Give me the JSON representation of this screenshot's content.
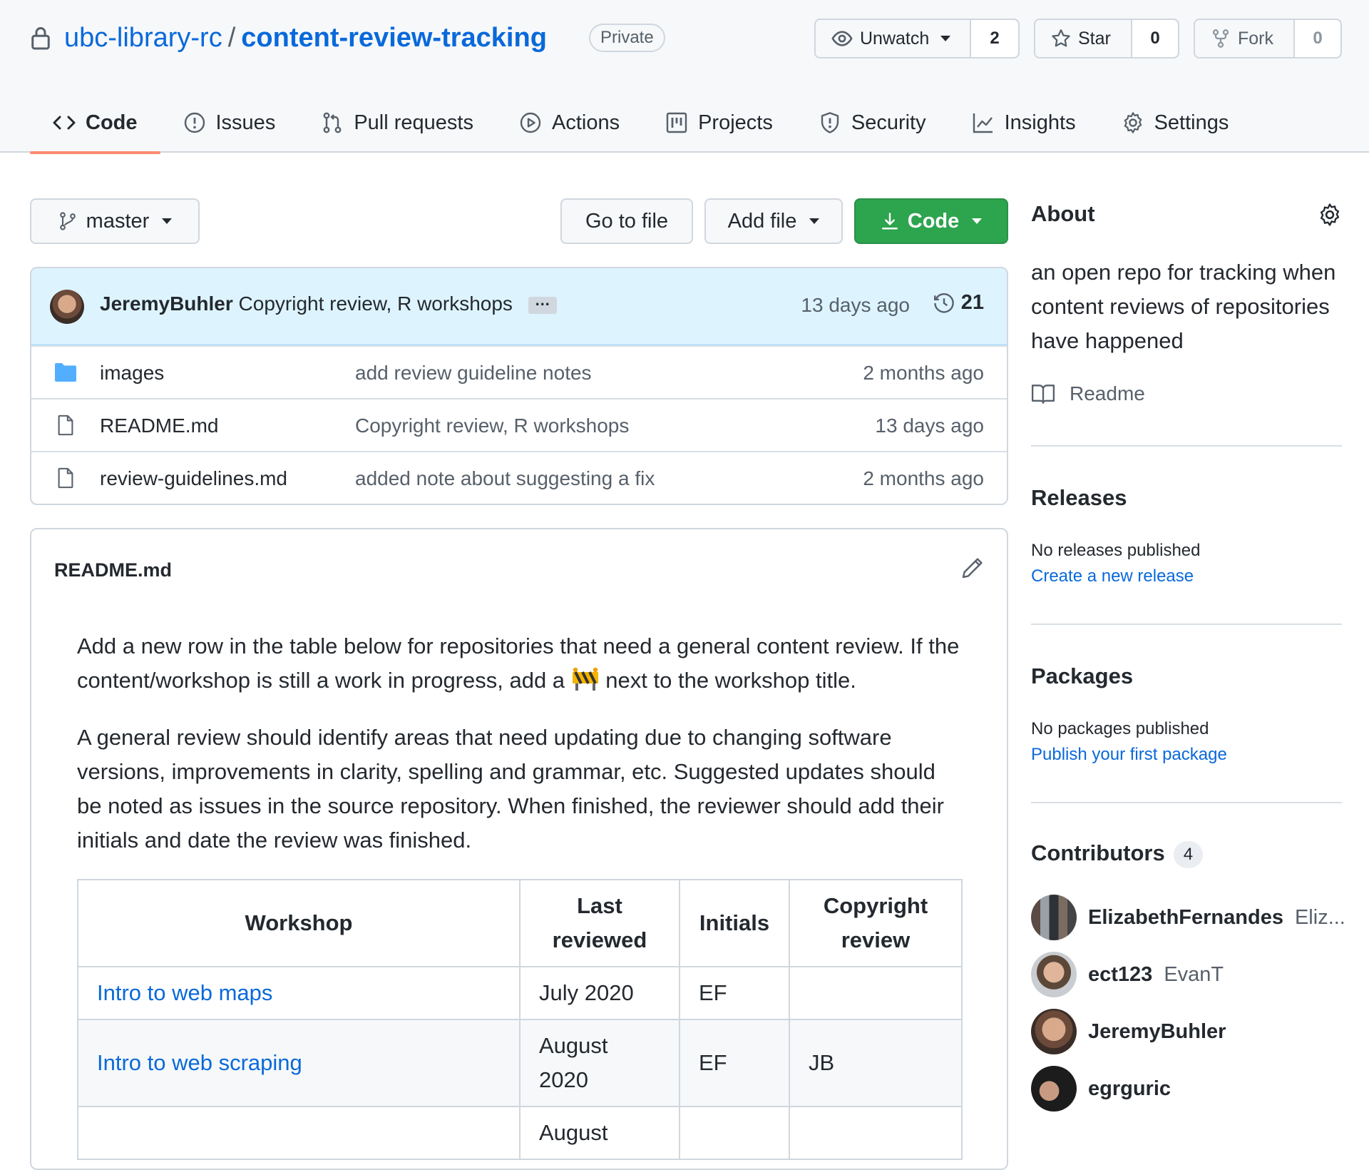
{
  "header": {
    "owner": "ubc-library-rc",
    "separator": "/",
    "repo": "content-review-tracking",
    "visibility": "Private",
    "watch_label": "Unwatch",
    "watch_count": "2",
    "star_label": "Star",
    "star_count": "0",
    "fork_label": "Fork",
    "fork_count": "0"
  },
  "tabs": [
    {
      "label": "Code",
      "icon": "code-icon",
      "active": true
    },
    {
      "label": "Issues",
      "icon": "issue-icon"
    },
    {
      "label": "Pull requests",
      "icon": "pull-request-icon"
    },
    {
      "label": "Actions",
      "icon": "play-icon"
    },
    {
      "label": "Projects",
      "icon": "project-icon"
    },
    {
      "label": "Security",
      "icon": "shield-icon"
    },
    {
      "label": "Insights",
      "icon": "graph-icon"
    },
    {
      "label": "Settings",
      "icon": "gear-icon"
    }
  ],
  "toolbar": {
    "branch": "master",
    "go_to_file": "Go to file",
    "add_file": "Add file",
    "code": "Code"
  },
  "latest_commit": {
    "author": "JeremyBuhler",
    "message": "Copyright review, R workshops",
    "ellipsis": "…",
    "when": "13 days ago",
    "commit_count": "21"
  },
  "files": [
    {
      "name": "images",
      "type": "folder",
      "message": "add review guideline notes",
      "when": "2 months ago"
    },
    {
      "name": "README.md",
      "type": "file",
      "message": "Copyright review, R workshops",
      "when": "13 days ago"
    },
    {
      "name": "review-guidelines.md",
      "type": "file",
      "message": "added note about suggesting a fix",
      "when": "2 months ago"
    }
  ],
  "readme": {
    "title": "README.md",
    "p1_a": "Add a new row in the table below for repositories that need a general content review. If the content/workshop is still a work in progress, add a",
    "p1_b": "next to the workshop title.",
    "p2": "A general review should identify areas that need updating due to changing software versions, improvements in clarity, spelling and grammar, etc. Suggested updates should be noted as issues in the source repository. When finished, the reviewer should add their initials and date the review was finished.",
    "table_headers": [
      "Workshop",
      "Last reviewed",
      "Initials",
      "Copyright review"
    ],
    "rows": [
      {
        "workshop": "Intro to web maps",
        "last_reviewed": "July 2020",
        "initials": "EF",
        "copyright": ""
      },
      {
        "workshop": "Intro to web scraping",
        "last_reviewed": "August 2020",
        "initials": "EF",
        "copyright": "JB"
      },
      {
        "workshop": "",
        "last_reviewed": "August",
        "initials": "",
        "copyright": ""
      }
    ]
  },
  "sidebar": {
    "about_title": "About",
    "about_desc": "an open repo for tracking when content reviews of repositories have happened",
    "readme_label": "Readme",
    "releases_title": "Releases",
    "releases_none": "No releases published",
    "releases_link": "Create a new release",
    "packages_title": "Packages",
    "packages_none": "No packages published",
    "packages_link": "Publish your first package",
    "contributors_title": "Contributors",
    "contributors_count": "4",
    "contributors": [
      {
        "login": "ElizabethFernandes",
        "name": "Eliz..."
      },
      {
        "login": "ect123",
        "name": "EvanT"
      },
      {
        "login": "JeremyBuhler",
        "name": ""
      },
      {
        "login": "egrguric",
        "name": ""
      }
    ]
  },
  "colors": {
    "link": "#0969da",
    "green_button": "#2da44e",
    "tab_underline": "#fd8c73",
    "commit_bar": "#ddf4ff"
  }
}
